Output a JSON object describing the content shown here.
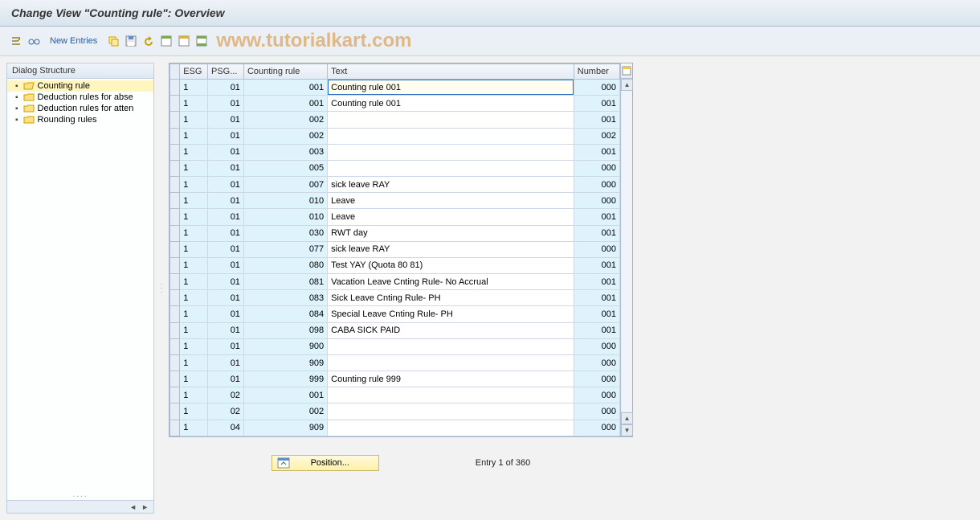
{
  "title": "Change View \"Counting rule\": Overview",
  "watermark": "www.tutorialkart.com",
  "toolbar": {
    "new_entries_label": "New Entries"
  },
  "dialog_structure": {
    "header": "Dialog Structure",
    "items": [
      {
        "label": "Counting rule",
        "open": true,
        "selected": true
      },
      {
        "label": "Deduction rules for abse",
        "open": false,
        "selected": false
      },
      {
        "label": "Deduction rules for atten",
        "open": false,
        "selected": false
      },
      {
        "label": "Rounding rules",
        "open": false,
        "selected": false
      }
    ]
  },
  "columns": {
    "esg": "ESG",
    "psg": "PSG...",
    "rule": "Counting rule",
    "text": "Text",
    "number": "Number"
  },
  "rows": [
    {
      "esg": "1",
      "psg": "01",
      "rule": "001",
      "text": "Counting rule 001",
      "number": "000",
      "selected": true
    },
    {
      "esg": "1",
      "psg": "01",
      "rule": "001",
      "text": "Counting rule 001",
      "number": "001"
    },
    {
      "esg": "1",
      "psg": "01",
      "rule": "002",
      "text": "",
      "number": "001"
    },
    {
      "esg": "1",
      "psg": "01",
      "rule": "002",
      "text": "",
      "number": "002"
    },
    {
      "esg": "1",
      "psg": "01",
      "rule": "003",
      "text": "",
      "number": "001"
    },
    {
      "esg": "1",
      "psg": "01",
      "rule": "005",
      "text": "",
      "number": "000"
    },
    {
      "esg": "1",
      "psg": "01",
      "rule": "007",
      "text": "sick leave RAY",
      "number": "000"
    },
    {
      "esg": "1",
      "psg": "01",
      "rule": "010",
      "text": "Leave",
      "number": "000"
    },
    {
      "esg": "1",
      "psg": "01",
      "rule": "010",
      "text": "Leave",
      "number": "001"
    },
    {
      "esg": "1",
      "psg": "01",
      "rule": "030",
      "text": "RWT day",
      "number": "001"
    },
    {
      "esg": "1",
      "psg": "01",
      "rule": "077",
      "text": "sick leave RAY",
      "number": "000"
    },
    {
      "esg": "1",
      "psg": "01",
      "rule": "080",
      "text": "Test YAY (Quota 80 81)",
      "number": "001"
    },
    {
      "esg": "1",
      "psg": "01",
      "rule": "081",
      "text": "Vacation Leave Cnting Rule- No Accrual",
      "number": "001"
    },
    {
      "esg": "1",
      "psg": "01",
      "rule": "083",
      "text": "Sick Leave Cnting Rule- PH",
      "number": "001"
    },
    {
      "esg": "1",
      "psg": "01",
      "rule": "084",
      "text": "Special Leave Cnting Rule- PH",
      "number": "001"
    },
    {
      "esg": "1",
      "psg": "01",
      "rule": "098",
      "text": "CABA SICK PAID",
      "number": "001"
    },
    {
      "esg": "1",
      "psg": "01",
      "rule": "900",
      "text": "",
      "number": "000"
    },
    {
      "esg": "1",
      "psg": "01",
      "rule": "909",
      "text": "",
      "number": "000"
    },
    {
      "esg": "1",
      "psg": "01",
      "rule": "999",
      "text": "Counting rule 999",
      "number": "000"
    },
    {
      "esg": "1",
      "psg": "02",
      "rule": "001",
      "text": "",
      "number": "000"
    },
    {
      "esg": "1",
      "psg": "02",
      "rule": "002",
      "text": "",
      "number": "000"
    },
    {
      "esg": "1",
      "psg": "04",
      "rule": "909",
      "text": "",
      "number": "000"
    }
  ],
  "footer": {
    "position_label": "Position...",
    "entry_info": "Entry 1 of 360"
  }
}
